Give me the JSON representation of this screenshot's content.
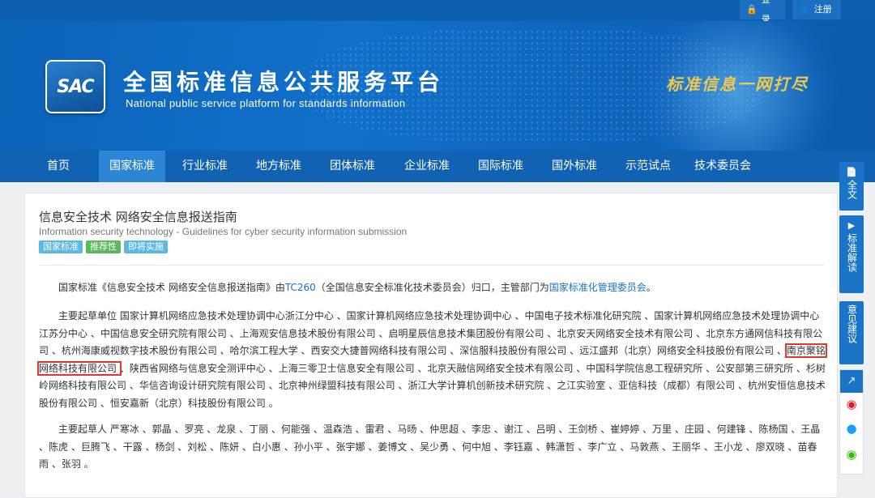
{
  "topbar": {
    "login_label": "登录",
    "register_label": "注册"
  },
  "header": {
    "logo_text": "SAC",
    "title_cn": "全国标准信息公共服务平台",
    "title_en": "National public service platform  for standards information",
    "slogan": "标准信息一网打尽"
  },
  "nav": {
    "items": [
      {
        "label": "首页"
      },
      {
        "label": "国家标准",
        "active": true
      },
      {
        "label": "行业标准"
      },
      {
        "label": "地方标准"
      },
      {
        "label": "团体标准"
      },
      {
        "label": "企业标准"
      },
      {
        "label": "国际标准"
      },
      {
        "label": "国外标准"
      },
      {
        "label": "示范试点"
      },
      {
        "label": "技术委员会"
      }
    ]
  },
  "document": {
    "title": "信息安全技术 网络安全信息报送指南",
    "title_en": "Information security technology - Guidelines for cyber security information submission",
    "badges": [
      "国家标准",
      "推荐性",
      "即将实施"
    ],
    "intro_prefix": "国家标准《信息安全技术 网络安全信息报送指南》由",
    "intro_tc": "TC260",
    "intro_middle": "（全国信息安全标准化技术委员会）归口，主管部门为",
    "intro_dept": "国家标准化管理委员会",
    "intro_suffix": "。",
    "drafting_units_label": "主要起草单位",
    "drafting_units_before": " 国家计算机网络应急技术处理协调中心浙江分中心 、国家计算机网络应急技术处理协调中心 、中国电子技术标准化研究院 、国家计算机网络应急技术处理协调中心江苏分中心 、中国信息安全研究院有限公司 、上海观安信息技术股份有限公司 、启明星辰信息技术集团股份有限公司 、北京安天网络安全技术有限公司 、北京东方通网信科技有限公司 、杭州海康威视数字技术股份有限公司 、哈尔滨工程大学 、西安交大捷普网络科技有限公司 、深信服科技股份有限公司 、远江盛邦（北京）网络安全科技股份有限公司 、",
    "drafting_units_highlight": "南京聚铭网络科技有限公司 ",
    "drafting_units_after": "、陕西省网络与信息安全测评中心 、上海三零卫士信息安全有限公司 、北京天融信网络安全技术有限公司 、中国科学院信息工程研究所 、公安部第三研究所 、杉树岭网络科技有限公司 、华信咨询设计研究院有限公司 、北京神州绿盟科技有限公司 、浙江大学计算机创新技术研究院 、之江实验室 、亚信科技（成都）有限公司 、杭州安恒信息技术股份有限公司 、恒安嘉新（北京）科技股份有限公司 。",
    "drafters_label": "主要起草人",
    "drafters": " 严寒冰 、郭晶 、罗亮 、龙泉 、丁丽 、何能强 、温森浩 、雷君 、马旸 、仲思超 、李忠 、谢江 、吕明 、王剑桥 、崔婷婷 、万里 、庄园 、何建锋 、陈杨国 、王晶 、陈虎 、巨腾飞 、干露 、杨剑 、刘松 、陈妍 、白小惠 、孙小平 、张宇娜 、姜博文 、吴少勇 、何中旭 、李钰嘉 、韩潇哲 、李广立 、马敦燕 、王丽华 、王小龙 、廖双晓 、苗春雨 、张羽 。"
  },
  "sidebar": {
    "fulltext_label": "全文",
    "interpretation_label": "标准解读",
    "feedback_label": "意见建议"
  },
  "colors": {
    "header_blue": "#0c63b8",
    "nav_blue": "#1262b4",
    "nav_active": "#2b86d6",
    "link_blue": "#1a73c9",
    "highlight_red": "#e03a2a",
    "slogan_gold": "#f2c94c"
  }
}
